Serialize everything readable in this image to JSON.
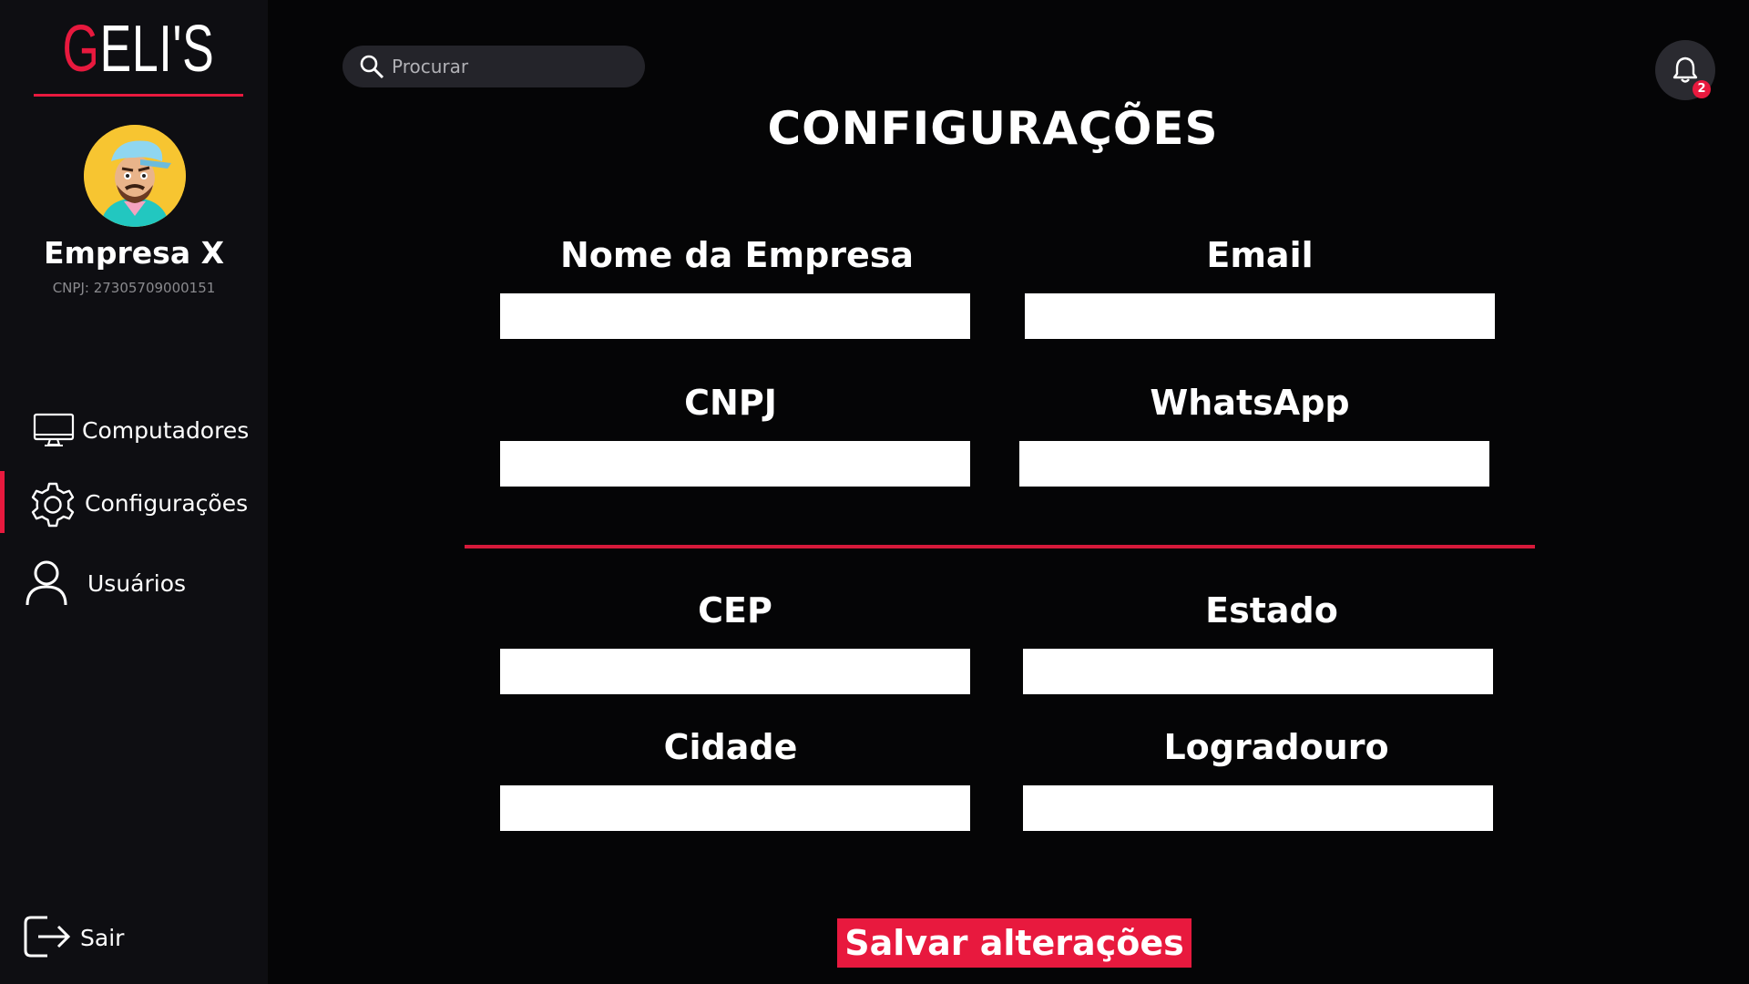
{
  "brand": {
    "logo_first_letter": "G",
    "logo_rest": "ELI'S",
    "accent_color": "#e8193e"
  },
  "profile": {
    "company_name": "Empresa X",
    "cnpj_text": "CNPJ: 27305709000151",
    "avatar_icon": "cartoon-avatar"
  },
  "nav": {
    "items": [
      {
        "label": "Computadores",
        "icon": "monitor-icon",
        "active": false
      },
      {
        "label": "Configurações",
        "icon": "gear-icon",
        "active": true
      },
      {
        "label": "Usuários",
        "icon": "user-icon",
        "active": false
      }
    ],
    "logout_label": "Sair",
    "logout_icon": "logout-icon"
  },
  "header": {
    "search_placeholder": "Procurar",
    "search_value": "",
    "notification_count": "2"
  },
  "page": {
    "title": "CONFIGURAÇÕES"
  },
  "form": {
    "company_name_label": "Nome da Empresa",
    "company_name_value": "",
    "email_label": "Email",
    "email_value": "",
    "cnpj_label": "CNPJ",
    "cnpj_value": "",
    "whatsapp_label": "WhatsApp",
    "whatsapp_value": "",
    "cep_label": "CEP",
    "cep_value": "",
    "estado_label": "Estado",
    "estado_value": "",
    "cidade_label": "Cidade",
    "cidade_value": "",
    "logradouro_label": "Logradouro",
    "logradouro_value": ""
  },
  "actions": {
    "save_label": "Salvar alterações"
  }
}
